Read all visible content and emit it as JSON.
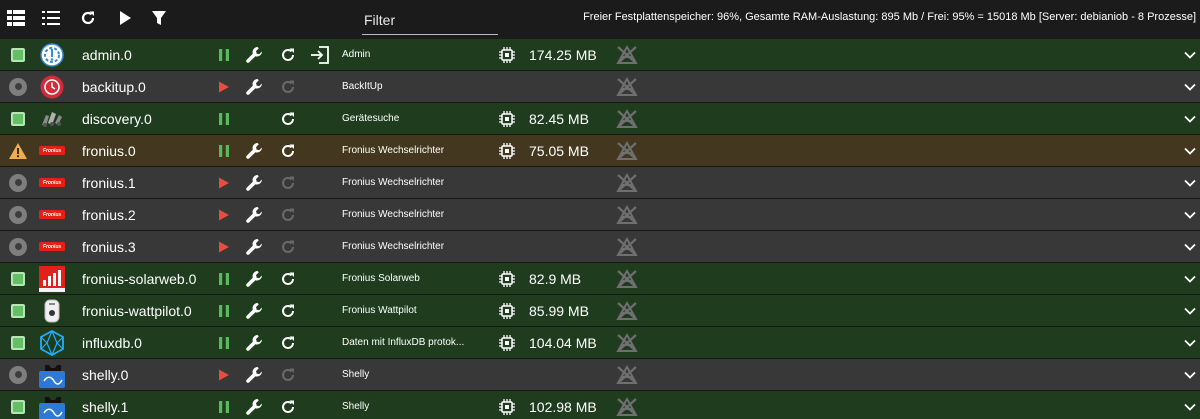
{
  "toolbar": {
    "filter_placeholder": "Filter",
    "status_text": "Freier Festplattenspeicher: 96%, Gesamte RAM-Auslastung: 895 Mb / Frei: 95% = 15018 Mb [Server: debianiob - 8 Prozesse]"
  },
  "colors": {
    "running_row": "#1f3c1f",
    "stopped_row": "#383838",
    "warning_row": "#43381f",
    "play_red": "#e74c3c",
    "pause_green": "#5cb85c"
  },
  "instances": [
    {
      "name": "admin.0",
      "title": "Admin",
      "memory": "174.25 MB",
      "state": "running",
      "icon": "admin-icon",
      "has_open": true,
      "has_wrench": true
    },
    {
      "name": "backitup.0",
      "title": "BackItUp",
      "memory": "",
      "state": "stopped",
      "icon": "backitup-icon",
      "has_open": false,
      "has_wrench": true
    },
    {
      "name": "discovery.0",
      "title": "Gerätesuche",
      "memory": "82.45 MB",
      "state": "running",
      "icon": "discovery-icon",
      "has_open": false,
      "has_wrench": false
    },
    {
      "name": "fronius.0",
      "title": "Fronius Wechselrichter",
      "memory": "75.05 MB",
      "state": "warning",
      "icon": "fronius-icon",
      "has_open": false,
      "has_wrench": true
    },
    {
      "name": "fronius.1",
      "title": "Fronius Wechselrichter",
      "memory": "",
      "state": "stopped",
      "icon": "fronius-icon",
      "has_open": false,
      "has_wrench": true
    },
    {
      "name": "fronius.2",
      "title": "Fronius Wechselrichter",
      "memory": "",
      "state": "stopped",
      "icon": "fronius-icon",
      "has_open": false,
      "has_wrench": true
    },
    {
      "name": "fronius.3",
      "title": "Fronius Wechselrichter",
      "memory": "",
      "state": "stopped",
      "icon": "fronius-icon",
      "has_open": false,
      "has_wrench": true
    },
    {
      "name": "fronius-solarweb.0",
      "title": "Fronius Solarweb",
      "memory": "82.9 MB",
      "state": "running",
      "icon": "solarweb-icon",
      "has_open": false,
      "has_wrench": true
    },
    {
      "name": "fronius-wattpilot.0",
      "title": "Fronius Wattpilot",
      "memory": "85.99 MB",
      "state": "running",
      "icon": "wattpilot-icon",
      "has_open": false,
      "has_wrench": true
    },
    {
      "name": "influxdb.0",
      "title": "Daten mit InfluxDB protok...",
      "memory": "104.04 MB",
      "state": "running",
      "icon": "influxdb-icon",
      "has_open": false,
      "has_wrench": true
    },
    {
      "name": "shelly.0",
      "title": "Shelly",
      "memory": "",
      "state": "stopped",
      "icon": "shelly-icon",
      "has_open": false,
      "has_wrench": true
    },
    {
      "name": "shelly.1",
      "title": "Shelly",
      "memory": "102.98 MB",
      "state": "running",
      "icon": "shelly-icon",
      "has_open": false,
      "has_wrench": true
    }
  ]
}
